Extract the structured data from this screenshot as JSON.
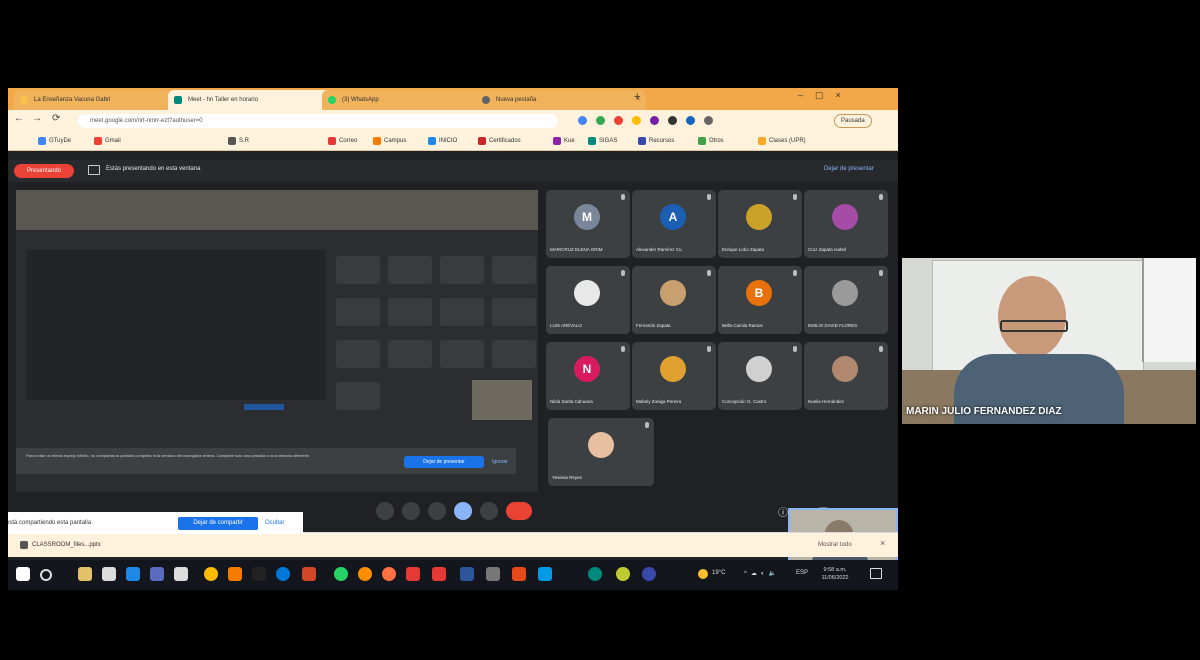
{
  "browser": {
    "tabs": [
      {
        "label": "La Enseñanza Vacuna Gabri"
      },
      {
        "label": "Meet - hn Taller en horario"
      },
      {
        "label": "(3) WhatsApp"
      },
      {
        "label": "Nueva pestaña"
      }
    ],
    "url": "meet.google.com/nrt-nmrr-ezt?authuser=0",
    "profile_label": "Pausada",
    "bookmarks": [
      "GTuyDe",
      "Gmail",
      "S.R",
      "Correo",
      "Campus",
      "INICIO",
      "Certificados",
      "Kue",
      "SIGAS",
      "Recursos",
      "Otros",
      "Clases (UPR)"
    ]
  },
  "meet": {
    "presenting_button": "Presentando",
    "presenting_text": "Estás presentando en esta ventana",
    "stop_presenting_top": "Dejar de presentar",
    "notice_text": "Para evitar un efecto espejo infinito, no compartas la pantalla completa ni la ventana del navegador entera. Comparte solo una pestaña o una ventana diferente.",
    "notice_stop": "Dejar de presentar",
    "notice_ignore": "Ignorar",
    "participants": [
      {
        "name": "MARICRUZ ELENA GRIM",
        "initial": "M",
        "color": "#7a869a"
      },
      {
        "name": "Alexander Ramírez Cu",
        "initial": "A",
        "color": "#1a5fb4"
      },
      {
        "name": "Enrique Lobo Zapata",
        "initial": "",
        "color": "#c9a227"
      },
      {
        "name": "Cruz Zapata Isabel",
        "initial": "",
        "color": "#a64ca6"
      },
      {
        "name": "LUIS ARÉVALO",
        "initial": "",
        "color": "#e8e8e8"
      },
      {
        "name": "Fernando Zapata",
        "initial": "",
        "color": "#c8a070"
      },
      {
        "name": "Bella Camila Ramos",
        "initial": "B",
        "color": "#e8710a"
      },
      {
        "name": "EMILIO DAVID FLORES",
        "initial": "",
        "color": "#9a9a9a"
      },
      {
        "name": "Nilda Sarita Cahuana",
        "initial": "N",
        "color": "#d81b60"
      },
      {
        "name": "Mabely Zuniga Pereira",
        "initial": "",
        "color": "#e0a030"
      },
      {
        "name": "Concepción G. Castro",
        "initial": "",
        "color": "#d0d0d0"
      },
      {
        "name": "Noelia Hernández",
        "initial": "",
        "color": "#b08870"
      },
      {
        "name": "Yesenia Reyes",
        "initial": "",
        "color": "#e8c0a0"
      }
    ],
    "share_info_text": "está compartiendo esta pantalla",
    "stop_sharing": "Dejar de compartir",
    "hide": "Ocultar"
  },
  "downloads": {
    "file": "CLASSROOM_files...pptx",
    "show_all": "Mostrar todo"
  },
  "taskbar": {
    "weather": "19°C",
    "lang": "ESP",
    "time": "9:58 a.m.",
    "date": "11/06/2022"
  },
  "camera": {
    "name": "MARIN JULIO FERNANDEZ DIAZ"
  }
}
